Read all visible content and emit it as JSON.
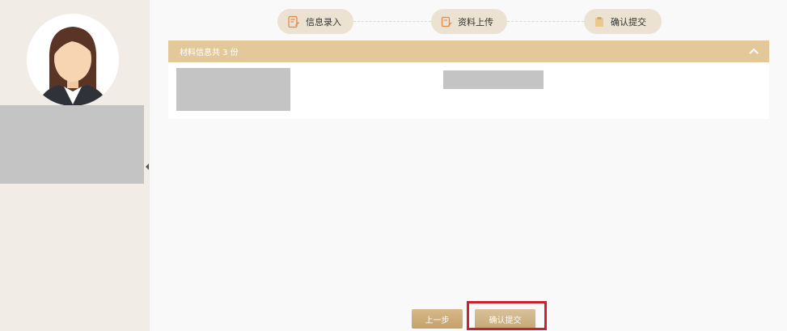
{
  "steps": [
    {
      "label": "信息录入"
    },
    {
      "label": "资料上传"
    },
    {
      "label": "确认提交"
    }
  ],
  "materials": {
    "header": "材料信息共 3 份"
  },
  "buttons": {
    "prev": "上一步",
    "submit": "确认提交"
  },
  "colors": {
    "accent": "#e3c99a",
    "highlight": "#c8232c",
    "step_bg": "#ece2d2"
  }
}
